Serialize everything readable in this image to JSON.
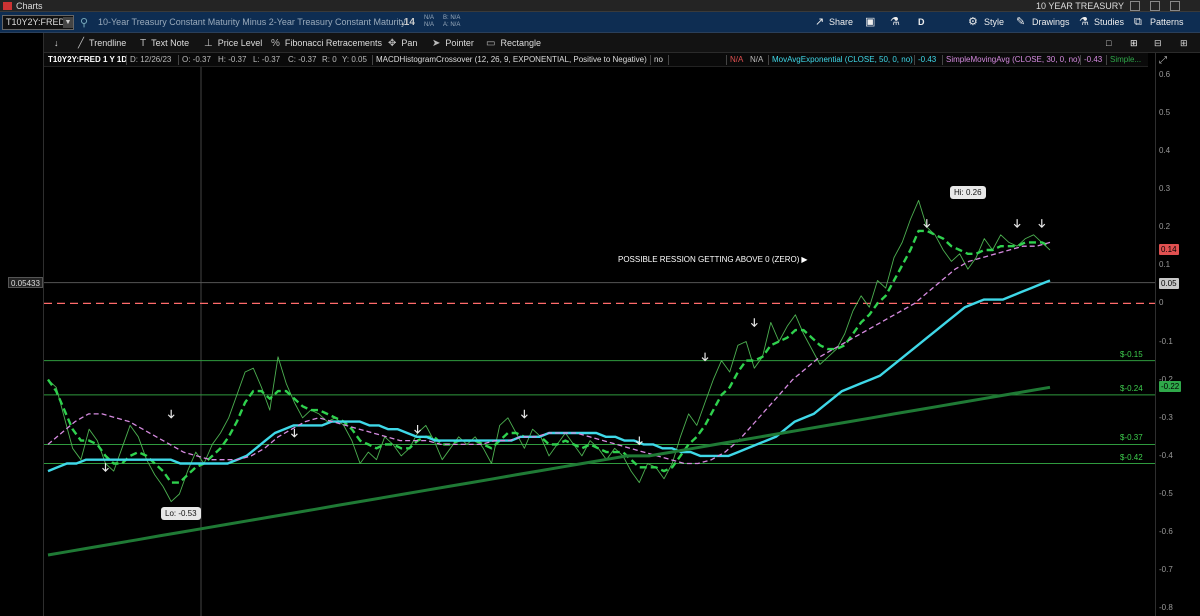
{
  "window": {
    "title": "Charts",
    "watchlist": "10 YEAR TREASURY"
  },
  "header": {
    "symbol": "T10Y2Y:FRED",
    "description": "10-Year Treasury Constant Maturity Minus 2-Year Treasury Constant Maturity",
    "last": ".14",
    "bid": "B: N/A",
    "ask": "A: N/A",
    "na1": "N/A",
    "na2": "N/A",
    "buttons": {
      "share": "Share",
      "period": "D",
      "style": "Style",
      "drawings": "Drawings",
      "studies": "Studies",
      "patterns": "Patterns"
    }
  },
  "toolbar": {
    "trendline": "Trendline",
    "textnote": "Text Note",
    "pricelevel": "Price Level",
    "fib": "Fibonacci Retracements",
    "pan": "Pan",
    "pointer": "Pointer",
    "rectangle": "Rectangle"
  },
  "info": {
    "title": "T10Y2Y:FRED 1 Y 1D",
    "date": "D: 12/26/23",
    "open": "O: -0.37",
    "high": "H: -0.37",
    "low": "L: -0.37",
    "close": "C: -0.37",
    "range": "R: 0",
    "y": "Y: 0.05",
    "study1": "MACDHistogramCrossover (12, 26, 9, EXPONENTIAL, Positive to Negative)",
    "study1_val": "no",
    "na_a": "N/A",
    "na_b": "N/A",
    "study2": "MovAvgExponential (CLOSE, 50, 0, no)",
    "study2_val": "-0.43",
    "study3": "SimpleMovingAvg (CLOSE, 30, 0, no)",
    "study3_val": "-0.43",
    "study4": "Simple..."
  },
  "chart_data": {
    "type": "line",
    "yaxis_ticks": [
      "0.6",
      "0.5",
      "0.4",
      "0.3",
      "0.2",
      "0.1",
      "0",
      "-0.1",
      "-0.2",
      "-0.3",
      "-0.4",
      "-0.5",
      "-0.6",
      "-0.7",
      "-0.8"
    ],
    "ylim": [
      -0.82,
      0.62
    ],
    "annotation": "POSSIBLE RESSION GETTING ABOVE 0 (ZERO)",
    "hi_label": "Hi: 0.26",
    "lo_label": "Lo: -0.53",
    "crosshair_value": "0.05433",
    "zero_line": 0,
    "price_levels": [
      {
        "label": "$-0.15",
        "value": -0.15
      },
      {
        "label": "$-0.24",
        "value": -0.24
      },
      {
        "label": "$-0.37",
        "value": -0.37
      },
      {
        "label": "$-0.42",
        "value": -0.42
      }
    ],
    "tags": [
      {
        "label": "0.14",
        "value": 0.14,
        "color": "#e05050"
      },
      {
        "label": "0.05",
        "value": 0.05,
        "color": "#c8c8c8"
      },
      {
        "label": "-0.22",
        "value": -0.22,
        "color": "#2fa84a"
      }
    ],
    "series": [
      {
        "name": "T10Y2Y",
        "color": "#4caf50",
        "values": [
          -0.2,
          -0.22,
          -0.3,
          -0.38,
          -0.41,
          -0.33,
          -0.36,
          -0.42,
          -0.44,
          -0.38,
          -0.32,
          -0.35,
          -0.41,
          -0.45,
          -0.48,
          -0.52,
          -0.5,
          -0.44,
          -0.39,
          -0.42,
          -0.37,
          -0.34,
          -0.3,
          -0.24,
          -0.18,
          -0.17,
          -0.22,
          -0.28,
          -0.14,
          -0.21,
          -0.26,
          -0.3,
          -0.28,
          -0.29,
          -0.31,
          -0.3,
          -0.32,
          -0.36,
          -0.42,
          -0.39,
          -0.41,
          -0.35,
          -0.37,
          -0.4,
          -0.38,
          -0.34,
          -0.32,
          -0.36,
          -0.41,
          -0.38,
          -0.35,
          -0.37,
          -0.35,
          -0.38,
          -0.42,
          -0.32,
          -0.3,
          -0.34,
          -0.38,
          -0.33,
          -0.35,
          -0.4,
          -0.37,
          -0.34,
          -0.37,
          -0.4,
          -0.36,
          -0.38,
          -0.41,
          -0.38,
          -0.4,
          -0.44,
          -0.47,
          -0.42,
          -0.43,
          -0.46,
          -0.42,
          -0.35,
          -0.29,
          -0.32,
          -0.26,
          -0.2,
          -0.15,
          -0.18,
          -0.11,
          -0.1,
          -0.17,
          -0.14,
          -0.05,
          -0.1,
          -0.06,
          -0.03,
          -0.08,
          -0.12,
          -0.16,
          -0.14,
          -0.12,
          -0.08,
          -0.02,
          0.02,
          -0.01,
          0.06,
          0.04,
          0.12,
          0.16,
          0.22,
          0.27,
          0.2,
          0.18,
          0.14,
          0.11,
          0.13,
          0.09,
          0.12,
          0.17,
          0.14,
          0.18,
          0.16,
          0.15,
          0.17,
          0.18,
          0.16,
          0.14
        ]
      },
      {
        "name": "MACD",
        "color": "#2fd14e",
        "values": [
          -0.2,
          -0.23,
          -0.28,
          -0.33,
          -0.36,
          -0.36,
          -0.37,
          -0.4,
          -0.42,
          -0.42,
          -0.4,
          -0.39,
          -0.4,
          -0.42,
          -0.44,
          -0.47,
          -0.47,
          -0.45,
          -0.43,
          -0.42,
          -0.4,
          -0.38,
          -0.35,
          -0.31,
          -0.26,
          -0.23,
          -0.23,
          -0.25,
          -0.23,
          -0.23,
          -0.25,
          -0.27,
          -0.28,
          -0.28,
          -0.29,
          -0.3,
          -0.31,
          -0.33,
          -0.36,
          -0.37,
          -0.38,
          -0.37,
          -0.37,
          -0.38,
          -0.38,
          -0.36,
          -0.35,
          -0.35,
          -0.37,
          -0.37,
          -0.36,
          -0.36,
          -0.36,
          -0.37,
          -0.38,
          -0.36,
          -0.34,
          -0.34,
          -0.35,
          -0.35,
          -0.35,
          -0.37,
          -0.37,
          -0.36,
          -0.37,
          -0.38,
          -0.37,
          -0.38,
          -0.39,
          -0.39,
          -0.39,
          -0.41,
          -0.43,
          -0.43,
          -0.43,
          -0.44,
          -0.43,
          -0.4,
          -0.37,
          -0.35,
          -0.32,
          -0.28,
          -0.24,
          -0.22,
          -0.18,
          -0.15,
          -0.15,
          -0.14,
          -0.11,
          -0.1,
          -0.09,
          -0.07,
          -0.07,
          -0.09,
          -0.11,
          -0.12,
          -0.12,
          -0.11,
          -0.08,
          -0.05,
          -0.03,
          0.0,
          0.02,
          0.06,
          0.1,
          0.14,
          0.19,
          0.19,
          0.18,
          0.17,
          0.15,
          0.14,
          0.13,
          0.13,
          0.14,
          0.14,
          0.15,
          0.15,
          0.15,
          0.16,
          0.16,
          0.16,
          0.15
        ]
      },
      {
        "name": "MovAvgExponential",
        "color": "#3fd8e8",
        "values": [
          -0.44,
          -0.43,
          -0.42,
          -0.42,
          -0.41,
          -0.41,
          -0.41,
          -0.41,
          -0.41,
          -0.41,
          -0.41,
          -0.41,
          -0.41,
          -0.41,
          -0.42,
          -0.42,
          -0.42,
          -0.42,
          -0.42,
          -0.42,
          -0.41,
          -0.4,
          -0.38,
          -0.36,
          -0.34,
          -0.33,
          -0.32,
          -0.32,
          -0.32,
          -0.32,
          -0.31,
          -0.31,
          -0.31,
          -0.31,
          -0.32,
          -0.32,
          -0.33,
          -0.33,
          -0.34,
          -0.35,
          -0.35,
          -0.36,
          -0.36,
          -0.36,
          -0.36,
          -0.36,
          -0.36,
          -0.36,
          -0.36,
          -0.36,
          -0.35,
          -0.35,
          -0.35,
          -0.34,
          -0.34,
          -0.34,
          -0.34,
          -0.34,
          -0.34,
          -0.35,
          -0.35,
          -0.36,
          -0.36,
          -0.37,
          -0.37,
          -0.38,
          -0.38,
          -0.39,
          -0.39,
          -0.4,
          -0.4,
          -0.4,
          -0.4,
          -0.39,
          -0.38,
          -0.37,
          -0.36,
          -0.35,
          -0.33,
          -0.31,
          -0.3,
          -0.29,
          -0.27,
          -0.25,
          -0.23,
          -0.22,
          -0.21,
          -0.2,
          -0.19,
          -0.17,
          -0.15,
          -0.13,
          -0.11,
          -0.09,
          -0.07,
          -0.05,
          -0.03,
          -0.01,
          0.0,
          0.01,
          0.01,
          0.01,
          0.02,
          0.03,
          0.04,
          0.05,
          0.06
        ]
      },
      {
        "name": "SimpleMovingAvg",
        "color": "#d68be0",
        "values": [
          -0.37,
          -0.34,
          -0.31,
          -0.29,
          -0.29,
          -0.3,
          -0.31,
          -0.33,
          -0.35,
          -0.37,
          -0.39,
          -0.4,
          -0.41,
          -0.41,
          -0.41,
          -0.4,
          -0.38,
          -0.35,
          -0.33,
          -0.31,
          -0.3,
          -0.31,
          -0.32,
          -0.33,
          -0.34,
          -0.35,
          -0.36,
          -0.36,
          -0.36,
          -0.37,
          -0.37,
          -0.37,
          -0.37,
          -0.36,
          -0.36,
          -0.35,
          -0.35,
          -0.34,
          -0.34,
          -0.34,
          -0.35,
          -0.36,
          -0.37,
          -0.38,
          -0.39,
          -0.4,
          -0.41,
          -0.42,
          -0.42,
          -0.41,
          -0.39,
          -0.36,
          -0.32,
          -0.28,
          -0.24,
          -0.2,
          -0.17,
          -0.14,
          -0.12,
          -0.1,
          -0.08,
          -0.06,
          -0.04,
          -0.02,
          0.0,
          0.03,
          0.06,
          0.09,
          0.11,
          0.12,
          0.13,
          0.14,
          0.15,
          0.15,
          0.16
        ]
      },
      {
        "name": "SimpleMovingAvg200",
        "color": "#1f7a35",
        "values": [
          -0.66,
          -0.65,
          -0.64,
          -0.63,
          -0.62,
          -0.61,
          -0.6,
          -0.59,
          -0.58,
          -0.57,
          -0.56,
          -0.55,
          -0.54,
          -0.53,
          -0.52,
          -0.51,
          -0.5,
          -0.49,
          -0.48,
          -0.47,
          -0.46,
          -0.45,
          -0.44,
          -0.43,
          -0.42,
          -0.41,
          -0.4,
          -0.4,
          -0.39,
          -0.38,
          -0.37,
          -0.36,
          -0.35,
          -0.34,
          -0.33,
          -0.32,
          -0.31,
          -0.3,
          -0.29,
          -0.28,
          -0.27,
          -0.26,
          -0.25,
          -0.24,
          -0.23,
          -0.22
        ]
      }
    ],
    "arrows": [
      {
        "i": 7,
        "v": -0.44
      },
      {
        "i": 15,
        "v": -0.3
      },
      {
        "i": 30,
        "v": -0.35
      },
      {
        "i": 45,
        "v": -0.34
      },
      {
        "i": 58,
        "v": -0.3
      },
      {
        "i": 72,
        "v": -0.37
      },
      {
        "i": 80,
        "v": -0.15
      },
      {
        "i": 86,
        "v": -0.06
      },
      {
        "i": 107,
        "v": 0.2
      },
      {
        "i": 118,
        "v": 0.2
      },
      {
        "i": 121,
        "v": 0.2
      }
    ]
  }
}
